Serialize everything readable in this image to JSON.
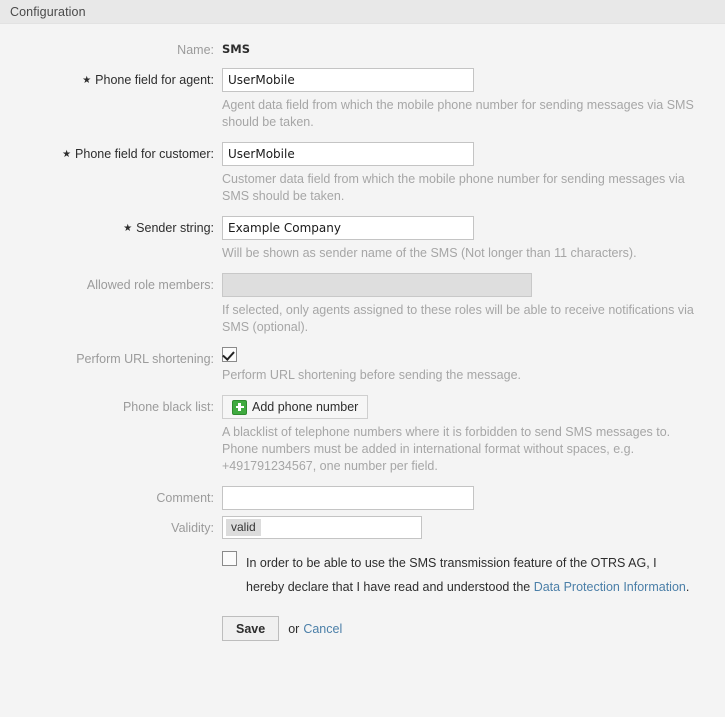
{
  "header": {
    "title": "Configuration"
  },
  "form": {
    "name": {
      "label": "Name:",
      "value": "SMS"
    },
    "phone_field_agent": {
      "label": "Phone field for agent:",
      "value": "UserMobile",
      "description": "Agent data field from which the mobile phone number for sending messages via SMS should be taken.",
      "required_marker": "★"
    },
    "phone_field_customer": {
      "label": "Phone field for customer:",
      "value": "UserMobile",
      "description": "Customer data field from which the mobile phone number for sending messages via SMS should be taken.",
      "required_marker": "★"
    },
    "sender_string": {
      "label": "Sender string:",
      "value": "Example Company",
      "description": "Will be shown as sender name of the SMS (Not longer than 11 characters).",
      "required_marker": "★"
    },
    "allowed_role_members": {
      "label": "Allowed role members:",
      "value": "",
      "description": "If selected, only agents assigned to these roles will be able to receive notifications via SMS (optional)."
    },
    "perform_url_shortening": {
      "label": "Perform URL shortening:",
      "checked": true,
      "description": "Perform URL shortening before sending the message."
    },
    "phone_black_list": {
      "label": "Phone black list:",
      "button_label": "Add phone number",
      "description": "A blacklist of telephone numbers where it is forbidden to send SMS messages to. Phone numbers must be added in international format without spaces, e.g. +491791234567, one number per field."
    },
    "comment": {
      "label": "Comment:",
      "value": "",
      "placeholder": ""
    },
    "validity": {
      "label": "Validity:",
      "selected": "valid"
    },
    "consent": {
      "checked": false,
      "text_before_link": "In order to be able to use the SMS transmission feature of the OTRS AG, I hereby declare that I have read and understood the ",
      "link_text": "Data Protection Information",
      "text_after_link": "."
    }
  },
  "footer": {
    "save_label": "Save",
    "or_label": "or",
    "cancel_label": "Cancel"
  },
  "colors": {
    "link": "#4b7fa8",
    "panel_header": "#e8e8e8",
    "panel_body": "#f4f4f4",
    "accent_green": "#3faa3f"
  }
}
